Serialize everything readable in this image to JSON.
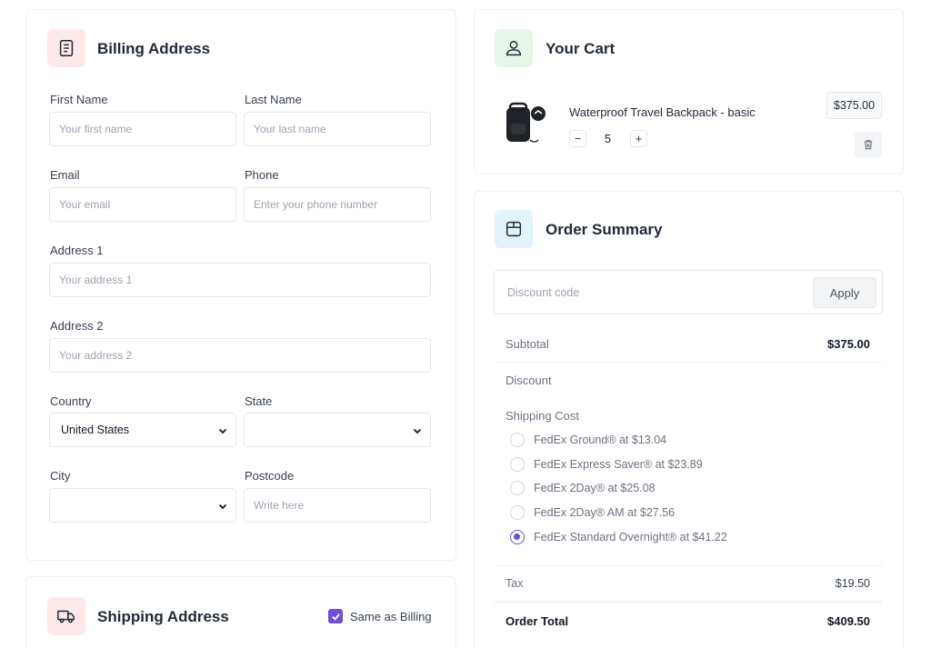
{
  "billing": {
    "title": "Billing Address",
    "first_name": {
      "label": "First Name",
      "placeholder": "Your first name"
    },
    "last_name": {
      "label": "Last Name",
      "placeholder": "Your last name"
    },
    "email": {
      "label": "Email",
      "placeholder": "Your email"
    },
    "phone": {
      "label": "Phone",
      "placeholder": "Enter your phone number"
    },
    "address1": {
      "label": "Address 1",
      "placeholder": "Your address 1"
    },
    "address2": {
      "label": "Address 2",
      "placeholder": "Your address 2"
    },
    "country": {
      "label": "Country",
      "value": "United States"
    },
    "state": {
      "label": "State",
      "value": ""
    },
    "city": {
      "label": "City",
      "value": ""
    },
    "postcode": {
      "label": "Postcode",
      "placeholder": "Write here"
    }
  },
  "shipping": {
    "title": "Shipping Address",
    "same_as_billing": "Same as Billing",
    "same_checked": true
  },
  "cart": {
    "title": "Your Cart",
    "item": {
      "name": "Waterproof Travel Backpack - basic",
      "price": "$375.00",
      "quantity": "5",
      "minus": "−",
      "plus": "+"
    }
  },
  "summary": {
    "title": "Order Summary",
    "discount_placeholder": "Discount code",
    "apply_label": "Apply",
    "subtotal_label": "Subtotal",
    "subtotal_value": "$375.00",
    "discount_label": "Discount",
    "shipping_label": "Shipping Cost",
    "shipping_options": [
      {
        "label": "FedEx Ground® at $13.04",
        "selected": false
      },
      {
        "label": "FedEx Express Saver® at $23.89",
        "selected": false
      },
      {
        "label": "FedEx 2Day® at $25.08",
        "selected": false
      },
      {
        "label": "FedEx 2Day® AM at $27.56",
        "selected": false
      },
      {
        "label": "FedEx Standard Overnight® at $41.22",
        "selected": true
      }
    ],
    "tax_label": "Tax",
    "tax_value": "$19.50",
    "total_label": "Order Total",
    "total_value": "$409.50"
  },
  "colors": {
    "accent": "#6d4fd8",
    "billing_icon_bg": "#fde8ea",
    "cart_icon_bg": "#e6f7e9",
    "summary_icon_bg": "#e3f3fb",
    "shipping_icon_bg": "#fde8ea"
  }
}
